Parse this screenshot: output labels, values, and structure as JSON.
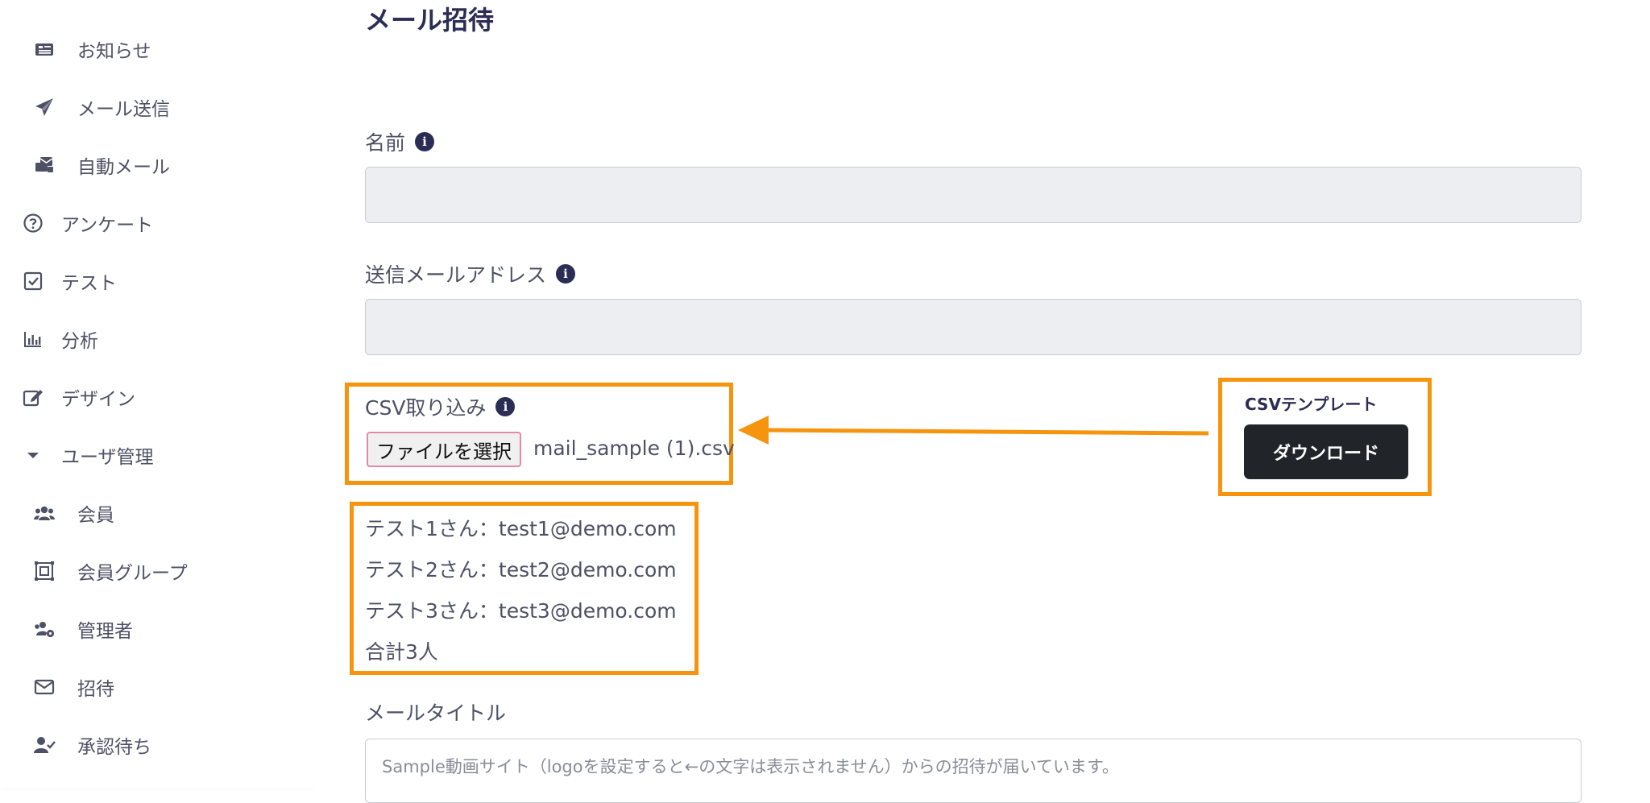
{
  "sidebar": {
    "items": [
      {
        "label": "お知らせ",
        "icon": "newspaper-icon"
      },
      {
        "label": "メール送信",
        "icon": "paper-plane-icon"
      },
      {
        "label": "自動メール",
        "icon": "mail-bulk-icon"
      },
      {
        "label": "アンケート",
        "icon": "question-circle-icon"
      },
      {
        "label": "テスト",
        "icon": "check-square-icon"
      },
      {
        "label": "分析",
        "icon": "bar-chart-icon"
      },
      {
        "label": "デザイン",
        "icon": "edit-icon"
      },
      {
        "label": "ユーザ管理",
        "icon": "caret-down-icon"
      },
      {
        "label": "会員",
        "icon": "users-icon"
      },
      {
        "label": "会員グループ",
        "icon": "group-icon"
      },
      {
        "label": "管理者",
        "icon": "users-cog-icon"
      },
      {
        "label": "招待",
        "icon": "envelope-icon"
      },
      {
        "label": "承認待ち",
        "icon": "user-check-icon"
      }
    ]
  },
  "main": {
    "title": "メール招待",
    "name_label": "名前",
    "sender_label": "送信メールアドレス",
    "csv_label": "CSV取り込み",
    "file_button": "ファイルを選択",
    "file_name": "mail_sample (1).csv",
    "csv_template_label": "CSVテンプレート",
    "download_button": "ダウンロード",
    "results": [
      "テスト1さん：test1@demo.com",
      "テスト2さん：test2@demo.com",
      "テスト3さん：test3@demo.com",
      "合計3人"
    ],
    "mail_title_label": "メールタイトル",
    "mail_title_value": "Sample動画サイト（logoを設定すると←の文字は表示されません）からの招待が届いています。"
  },
  "colors": {
    "accent": "#f7940e",
    "dark": "#212529",
    "title": "#2c2d55"
  }
}
